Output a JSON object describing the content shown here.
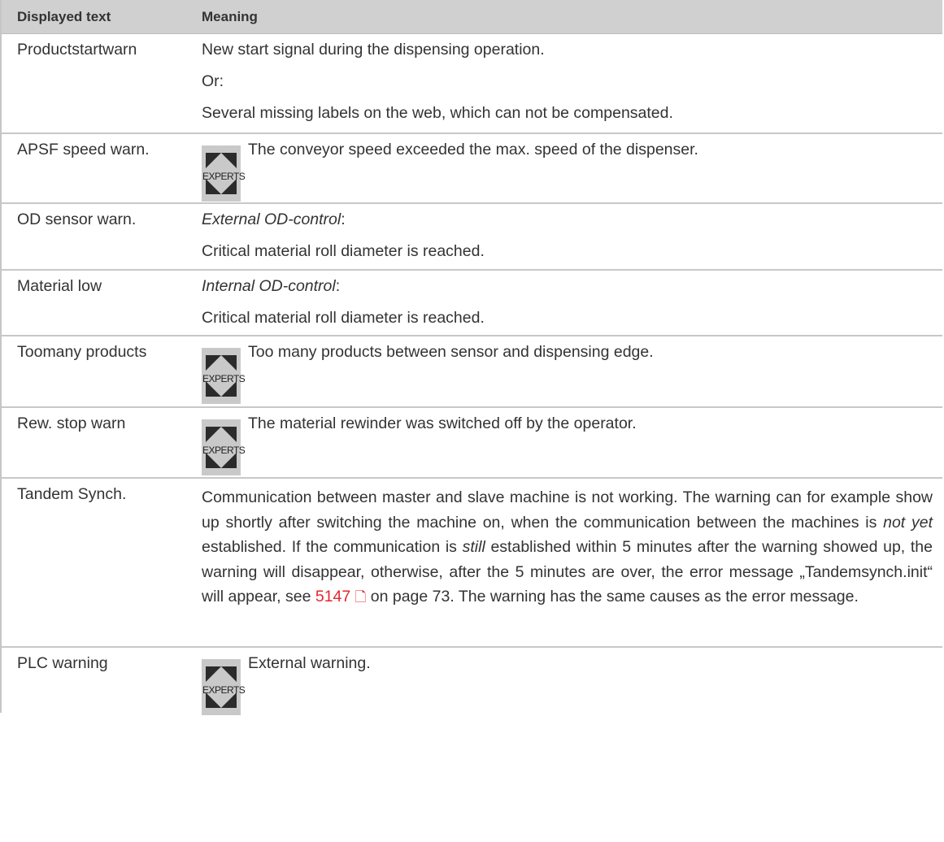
{
  "header": {
    "col1": "Displayed text",
    "col2": "Meaning"
  },
  "rows": {
    "r1": {
      "name": "Productstartwarn",
      "l1": "New start signal during the dispensing operation.",
      "l2": "Or:",
      "l3": "Several missing labels on the web, which can not be compensated."
    },
    "r2": {
      "name": "APSF speed warn.",
      "text": "The conveyor speed exceeded the max. speed of the dispenser."
    },
    "r3": {
      "name": "OD sensor warn.",
      "italic": "External OD-control",
      "colon": ":",
      "l2": "Critical material roll diameter is reached."
    },
    "r4": {
      "name": "Material low",
      "italic": "Internal OD-control",
      "colon": ":",
      "l2": "Critical material roll diameter is reached."
    },
    "r5": {
      "name": "Toomany products",
      "text": "Too many products between sensor and dispensing edge."
    },
    "r6": {
      "name": "Rew. stop warn",
      "text": "The material rewinder was switched off by the operator."
    },
    "r7": {
      "name": "Tandem Synch.",
      "t1": "Communication between master and slave machine is not working. The warning can for example show up shortly after switching the machine on, when the communication between the machines is ",
      "em1": "not yet",
      "t2": " established. If the communication is ",
      "em2": "still",
      "t3": " established within 5 minutes after the warning showed up, the warning will disappear, otherwise, after the 5 minutes are over, the error message „Tandemsynch.init“ will appear, see ",
      "link": "5147",
      "t4": " on page 73. The warning has the same causes as the error message."
    },
    "r8": {
      "name": "PLC warning",
      "text": "External warning."
    }
  },
  "expert_badge": {
    "label": "EXPERTS",
    "icon": "experts-icon",
    "bg": "#c9c9c9",
    "fg": "#2b2b2b"
  },
  "colors": {
    "link": "#e3262e",
    "header_bg": "#d0d0d0",
    "border": "#c8c8c8"
  }
}
